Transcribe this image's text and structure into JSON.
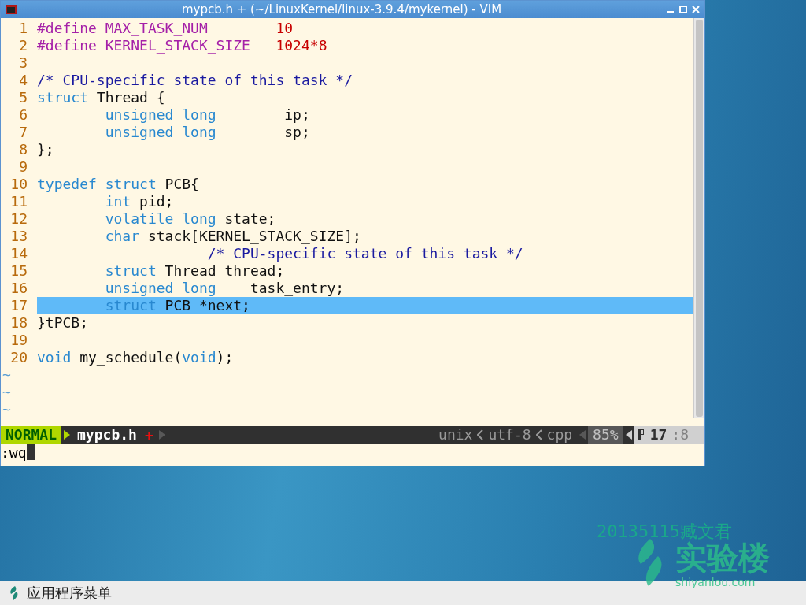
{
  "window": {
    "title": "mypcb.h + (~/LinuxKernel/linux-3.9.4/mykernel) - VIM"
  },
  "editor": {
    "lines": [
      {
        "number": "1",
        "selected": false,
        "tokens": [
          {
            "kind": "preproc",
            "text": "#define MAX_TASK_NUM"
          },
          {
            "kind": "number",
            "text": "        10"
          }
        ]
      },
      {
        "number": "2",
        "selected": false,
        "tokens": [
          {
            "kind": "preproc",
            "text": "#define KERNEL_STACK_SIZE"
          },
          {
            "kind": "number",
            "text": "   1024*8"
          }
        ]
      },
      {
        "number": "3",
        "selected": false
      },
      {
        "number": "4",
        "selected": false,
        "tokens": [
          {
            "kind": "comment",
            "text": "/* CPU-specific state of this task */"
          }
        ]
      },
      {
        "number": "5",
        "selected": false,
        "tokens": [
          {
            "kind": "type",
            "text": "struct"
          },
          {
            "kind": "plain",
            "text": " Thread {"
          }
        ]
      },
      {
        "number": "6",
        "selected": false,
        "tokens": [
          {
            "kind": "type",
            "text": "        unsigned long"
          },
          {
            "kind": "plain",
            "text": "        ip;"
          }
        ]
      },
      {
        "number": "7",
        "selected": false,
        "tokens": [
          {
            "kind": "type",
            "text": "        unsigned long"
          },
          {
            "kind": "plain",
            "text": "        sp;"
          }
        ]
      },
      {
        "number": "8",
        "selected": false,
        "tokens": [
          {
            "kind": "plain",
            "text": "};"
          }
        ]
      },
      {
        "number": "9",
        "selected": false
      },
      {
        "number": "10",
        "selected": false,
        "tokens": [
          {
            "kind": "type",
            "text": "typedef struct"
          },
          {
            "kind": "plain",
            "text": " PCB{"
          }
        ]
      },
      {
        "number": "11",
        "selected": false,
        "tokens": [
          {
            "kind": "type",
            "text": "        int"
          },
          {
            "kind": "plain",
            "text": " pid;"
          }
        ]
      },
      {
        "number": "12",
        "selected": false,
        "tokens": [
          {
            "kind": "type",
            "text": "        volatile long"
          },
          {
            "kind": "plain",
            "text": " state;"
          }
        ]
      },
      {
        "number": "13",
        "selected": false,
        "tokens": [
          {
            "kind": "type",
            "text": "        char"
          },
          {
            "kind": "plain",
            "text": " stack[KERNEL_STACK_SIZE];"
          }
        ]
      },
      {
        "number": "14",
        "selected": false,
        "tokens": [
          {
            "kind": "comment",
            "text": "                    /* CPU-specific state of this task */"
          }
        ]
      },
      {
        "number": "15",
        "selected": false,
        "tokens": [
          {
            "kind": "type",
            "text": "        struct"
          },
          {
            "kind": "plain",
            "text": " Thread thread;"
          }
        ]
      },
      {
        "number": "16",
        "selected": false,
        "tokens": [
          {
            "kind": "type",
            "text": "        unsigned long"
          },
          {
            "kind": "plain",
            "text": "    task_entry;"
          }
        ]
      },
      {
        "number": "17",
        "selected": true,
        "tokens": [
          {
            "kind": "type",
            "text": "        struct"
          },
          {
            "kind": "plain",
            "text": " PCB *next;"
          }
        ]
      },
      {
        "number": "18",
        "selected": false,
        "tokens": [
          {
            "kind": "plain",
            "text": "}tPCB;"
          }
        ]
      },
      {
        "number": "19",
        "selected": false
      },
      {
        "number": "20",
        "selected": false,
        "tokens": [
          {
            "kind": "type",
            "text": "void"
          },
          {
            "kind": "plain",
            "text": " my_schedule("
          },
          {
            "kind": "type",
            "text": "void"
          },
          {
            "kind": "plain",
            "text": ");"
          }
        ]
      }
    ],
    "filler": [
      "~",
      "~",
      "~"
    ]
  },
  "statusline": {
    "mode": "NORMAL",
    "file": "mypcb.h",
    "modified_flag": "+",
    "fileformat": "unix",
    "encoding": "utf-8",
    "filetype": "cpp",
    "percent": "85%",
    "line": "17",
    "column": ":8"
  },
  "command_line": {
    "value": ":wq"
  },
  "desktop": {
    "caption": "20135115臧文君",
    "logo_text": "实验楼",
    "logo_url": "shiyanlou.com"
  },
  "taskbar": {
    "menu_label": "应用程序菜单"
  }
}
